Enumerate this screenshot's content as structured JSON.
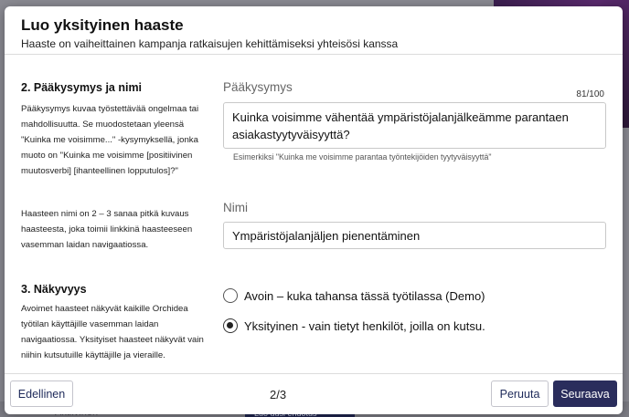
{
  "background": {
    "bottom_text": "Aktiivinen",
    "bottom_button": "Luo uusi ehdotus"
  },
  "modal": {
    "title": "Luo yksityinen haaste",
    "subtitle": "Haaste on vaiheittainen kampanja ratkaisujen kehittämiseksi yhteisösi kanssa"
  },
  "section_question": {
    "title": "2. Pääkysymys ja nimi",
    "description": "Pääkysymys kuvaa työstettävää ongelmaa tai mahdollisuutta. Se muodostetaan yleensä \"Kuinka me voisimme...\" -kysymyksellä, jonka muoto on \"Kuinka me voisimme [positiivinen muutosverbi] [ihanteellinen lopputulos]?\"",
    "name_description": "Haasteen nimi on 2 – 3 sanaa pitkä kuvaus haasteesta, joka toimii linkkinä haasteeseen vasemman laidan navigaatiossa."
  },
  "question_field": {
    "label": "Pääkysymys",
    "counter": "81/100",
    "value": "Kuinka voisimme vähentää ympäristöjalanjälkeämme parantaen asiakastyytyväisyyttä?",
    "hint": "Esimerkiksi \"Kuinka me voisimme parantaa työntekijöiden tyytyväisyyttä\""
  },
  "name_field": {
    "label": "Nimi",
    "value": "Ympäristöjalanjäljen pienentäminen"
  },
  "section_visibility": {
    "title": "3. Näkyvyys",
    "description": "Avoimet haasteet näkyvät kaikille Orchidea työtilan käyttäjille vasemman laidan navigaatiossa. Yksityiset haasteet näkyvät vain niihin kutsutuille käyttäjille ja vieraille.",
    "options": [
      {
        "label": "Avoin – kuka tahansa tässä työtilassa (Demo)",
        "selected": false
      },
      {
        "label": "Yksityinen - vain tietyt henkilöt, joilla on kutsu.",
        "selected": true
      }
    ]
  },
  "footer": {
    "prev_label": "Edellinen",
    "page": "2/3",
    "cancel_label": "Peruuta",
    "next_label": "Seuraava"
  },
  "colors": {
    "primary": "#2a2d5c",
    "border": "#c9c9c9",
    "overlay": "#6b6b73"
  }
}
